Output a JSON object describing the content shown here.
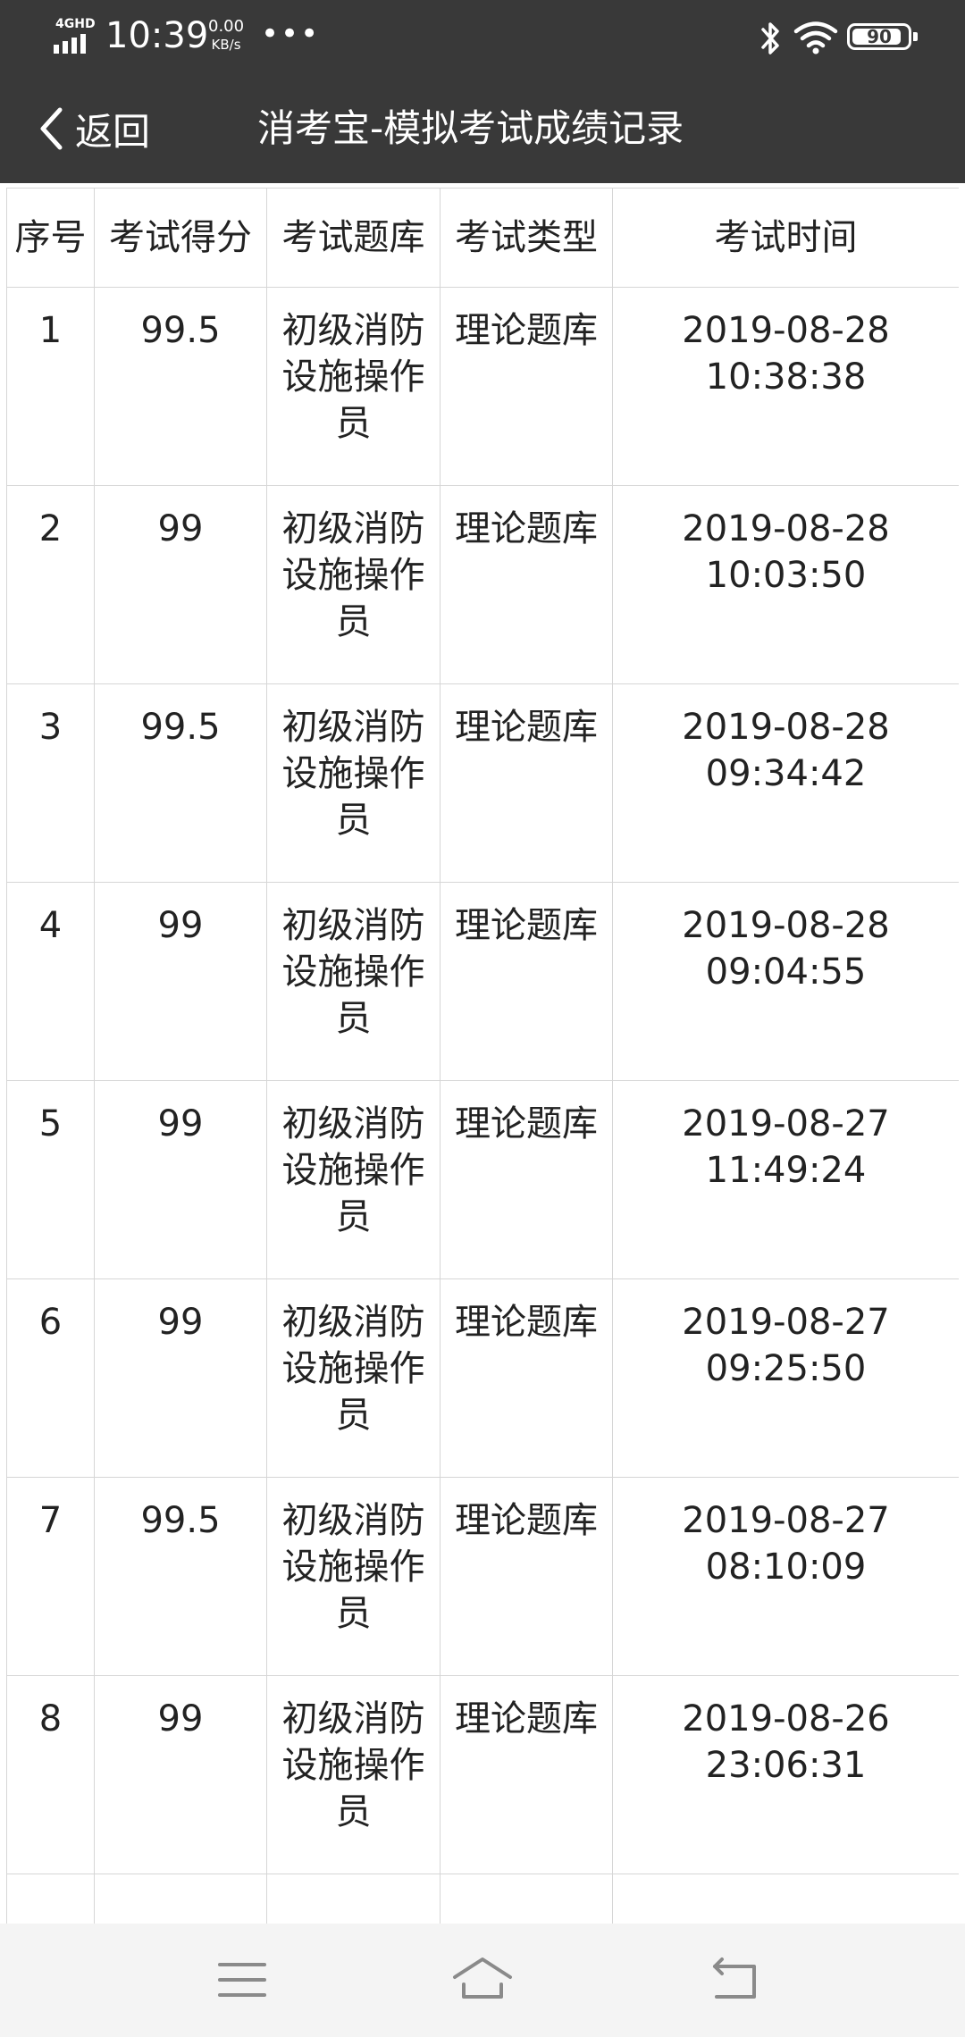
{
  "status_bar": {
    "network": "4GHD",
    "time": "10:39",
    "speed_value": "0.00",
    "speed_unit": "KB/s",
    "more": "•••",
    "battery": "90"
  },
  "header": {
    "back_label": "返回",
    "title": "消考宝-模拟考试成绩记录"
  },
  "table": {
    "columns": [
      "序号",
      "考试得分",
      "考试题库",
      "考试类型",
      "考试时间"
    ],
    "rows": [
      {
        "no": "1",
        "score": "99.5",
        "bank": "初级消防设施操作员",
        "type": "理论题库",
        "date": "2019-08-28",
        "clock": "10:38:38"
      },
      {
        "no": "2",
        "score": "99",
        "bank": "初级消防设施操作员",
        "type": "理论题库",
        "date": "2019-08-28",
        "clock": "10:03:50"
      },
      {
        "no": "3",
        "score": "99.5",
        "bank": "初级消防设施操作员",
        "type": "理论题库",
        "date": "2019-08-28",
        "clock": "09:34:42"
      },
      {
        "no": "4",
        "score": "99",
        "bank": "初级消防设施操作员",
        "type": "理论题库",
        "date": "2019-08-28",
        "clock": "09:04:55"
      },
      {
        "no": "5",
        "score": "99",
        "bank": "初级消防设施操作员",
        "type": "理论题库",
        "date": "2019-08-27",
        "clock": "11:49:24"
      },
      {
        "no": "6",
        "score": "99",
        "bank": "初级消防设施操作员",
        "type": "理论题库",
        "date": "2019-08-27",
        "clock": "09:25:50"
      },
      {
        "no": "7",
        "score": "99.5",
        "bank": "初级消防设施操作员",
        "type": "理论题库",
        "date": "2019-08-27",
        "clock": "08:10:09"
      },
      {
        "no": "8",
        "score": "99",
        "bank": "初级消防设施操作员",
        "type": "理论题库",
        "date": "2019-08-26",
        "clock": "23:06:31"
      }
    ]
  },
  "icons": {
    "back": "chevron-left-icon",
    "menu": "menu-icon",
    "home": "home-icon",
    "return": "return-icon",
    "bluetooth": "bluetooth-icon",
    "wifi": "wifi-icon",
    "signal": "signal-icon",
    "battery": "battery-icon"
  },
  "colors": {
    "top_bar": "#393939",
    "grid": "#d6d6d6",
    "nav_bar": "#f4f4f4"
  }
}
